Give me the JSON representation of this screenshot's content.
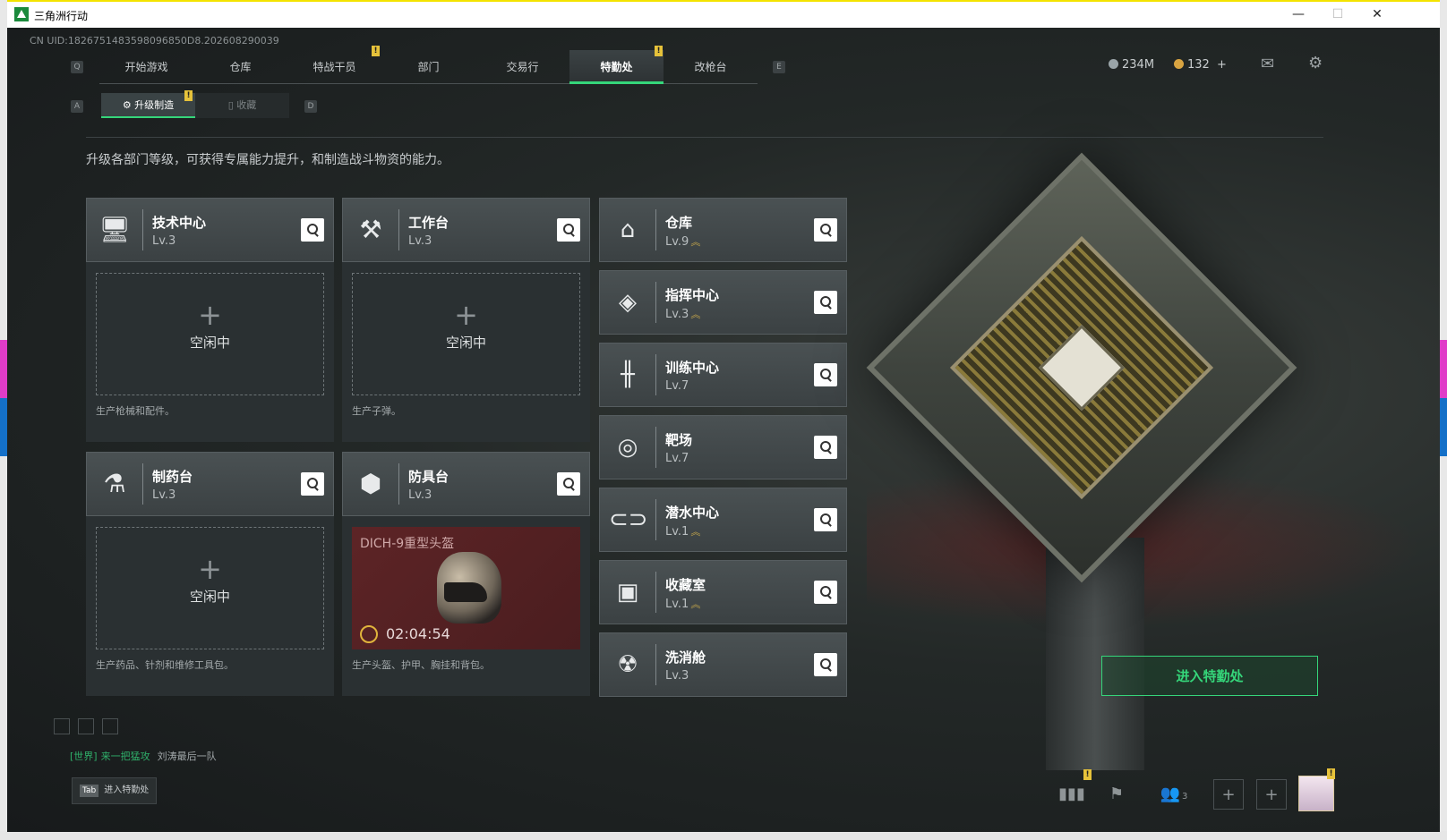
{
  "window": {
    "title": "三角洲行动",
    "minimize": "—",
    "maximize": "☐",
    "close": "✕"
  },
  "uid": "CN UID:1826751483598096850D8.202608290039",
  "topnav": {
    "left_key": "Q",
    "right_key": "E",
    "tabs": [
      "开始游戏",
      "仓库",
      "特战干员",
      "部门",
      "交易行",
      "特勤处",
      "改枪台"
    ],
    "active": "特勤处"
  },
  "currency": {
    "coins": "234M",
    "tickets": "132",
    "add": "+"
  },
  "subnav": {
    "left_key": "A",
    "right_key": "D",
    "tabs": [
      "升级制造",
      "收藏"
    ],
    "active": "升级制造"
  },
  "description": "升级各部门等级，可获得专属能力提升，和制造战斗物资的能力。",
  "production": [
    {
      "name": "技术中心",
      "level": "Lv.3",
      "status": "空闲中",
      "plus": "+",
      "desc": "生产枪械和配件。"
    },
    {
      "name": "工作台",
      "level": "Lv.3",
      "status": "空闲中",
      "plus": "+",
      "desc": "生产子弹。"
    },
    {
      "name": "制药台",
      "level": "Lv.3",
      "status": "空闲中",
      "plus": "+",
      "desc": "生产药品、针剂和维修工具包。"
    },
    {
      "name": "防具台",
      "level": "Lv.3",
      "crafting_item": "DICH-9重型头盔",
      "timer": "02:04:54",
      "desc": "生产头盔、护甲、胸挂和背包。"
    }
  ],
  "facilities": [
    {
      "name": "仓库",
      "level": "Lv.9",
      "up": "︽"
    },
    {
      "name": "指挥中心",
      "level": "Lv.3",
      "up": "︽"
    },
    {
      "name": "训练中心",
      "level": "Lv.7",
      "up": ""
    },
    {
      "name": "靶场",
      "level": "Lv.7",
      "up": ""
    },
    {
      "name": "潜水中心",
      "level": "Lv.1",
      "up": "︽"
    },
    {
      "name": "收藏室",
      "level": "Lv.1",
      "up": "︽"
    },
    {
      "name": "洗消舱",
      "level": "Lv.3",
      "up": ""
    }
  ],
  "enter_button": "进入特勤处",
  "chat": {
    "channel": "[世界]",
    "sender": "来一把猛攻",
    "message": "刘涛最后一队"
  },
  "tab_hint": {
    "key": "Tab",
    "label": "进入特勤处"
  },
  "badge_mark": "!",
  "friends_count": "3",
  "colors": {
    "accent": "#35d67a",
    "badge": "#e6c23a",
    "crafting_bg": "#5d2426"
  }
}
